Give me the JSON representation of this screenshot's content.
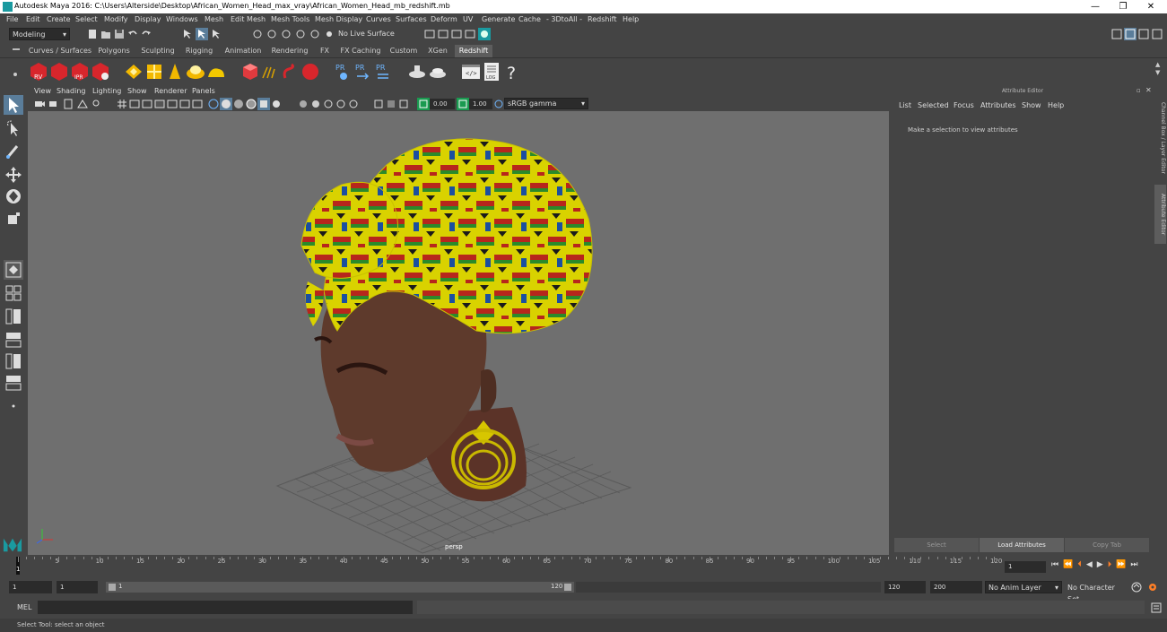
{
  "title_bar": {
    "title": "Autodesk Maya 2016: C:\\Users\\Alterside\\Desktop\\African_Women_Head_max_vray\\African_Women_Head_mb_redshift.mb",
    "minimize": "—",
    "restore": "❐",
    "close": "✕"
  },
  "menu": [
    "File",
    "Edit",
    "Create",
    "Select",
    "Modify",
    "Display",
    "Windows",
    "Mesh",
    "Edit Mesh",
    "Mesh Tools",
    "Mesh Display",
    "Curves",
    "Surfaces",
    "Deform",
    "UV",
    "Generate",
    "Cache",
    "- 3DtoAll -",
    "Redshift",
    "Help"
  ],
  "status_line": {
    "menu_set": "Modeling",
    "live_surface": "No Live Surface"
  },
  "shelf_tabs": [
    "Curves / Surfaces",
    "Polygons",
    "Sculpting",
    "Rigging",
    "Animation",
    "Rendering",
    "FX",
    "FX Caching",
    "Custom",
    "XGen",
    "Redshift"
  ],
  "active_shelf_tab": "Redshift",
  "shelf_icon_labels": [
    "RV",
    "IPR",
    "PR",
    "PR",
    "PR",
    "LOG",
    "?"
  ],
  "viewport_menu": [
    "View",
    "Shading",
    "Lighting",
    "Show",
    "Renderer",
    "Panels"
  ],
  "viewport_toolbar": {
    "exposure": "0.00",
    "gamma": "1.00",
    "color_space": "sRGB gamma"
  },
  "viewport": {
    "camera_label": "persp"
  },
  "attribute_editor": {
    "header": "Attribute Editor",
    "menu": [
      "List",
      "Selected",
      "Focus",
      "Attributes",
      "Show",
      "Help"
    ],
    "message": "Make a selection to view attributes",
    "buttons": [
      "Select",
      "Load Attributes",
      "Copy Tab"
    ]
  },
  "side_tabs": [
    "Channel Box / Layer Editor",
    "Attribute Editor"
  ],
  "time_slider": {
    "ticks": [
      "1",
      "5",
      "10",
      "15",
      "20",
      "25",
      "30",
      "35",
      "40",
      "45",
      "50",
      "55",
      "60",
      "65",
      "70",
      "75",
      "80",
      "85",
      "90",
      "95",
      "100",
      "105",
      "110",
      "115",
      "120"
    ],
    "current_frame": "1",
    "playhead_label": "1"
  },
  "range_slider": {
    "start_field": "1",
    "start_inner": "1",
    "range_start_label": "1",
    "range_end_label": "120",
    "end_inner": "120",
    "end_field": "200",
    "anim_layer": "No Anim Layer",
    "character_set": "No Character Set"
  },
  "command_line": {
    "language": "MEL"
  },
  "help_line": "Select Tool: select an object",
  "colors": {
    "ui_bg": "#444444",
    "viewport_bg": "#6f6f6f",
    "active_tab": "#5d5d5d",
    "accent_cyan": "#1a9aa0",
    "redshift_red": "#d8262c"
  }
}
